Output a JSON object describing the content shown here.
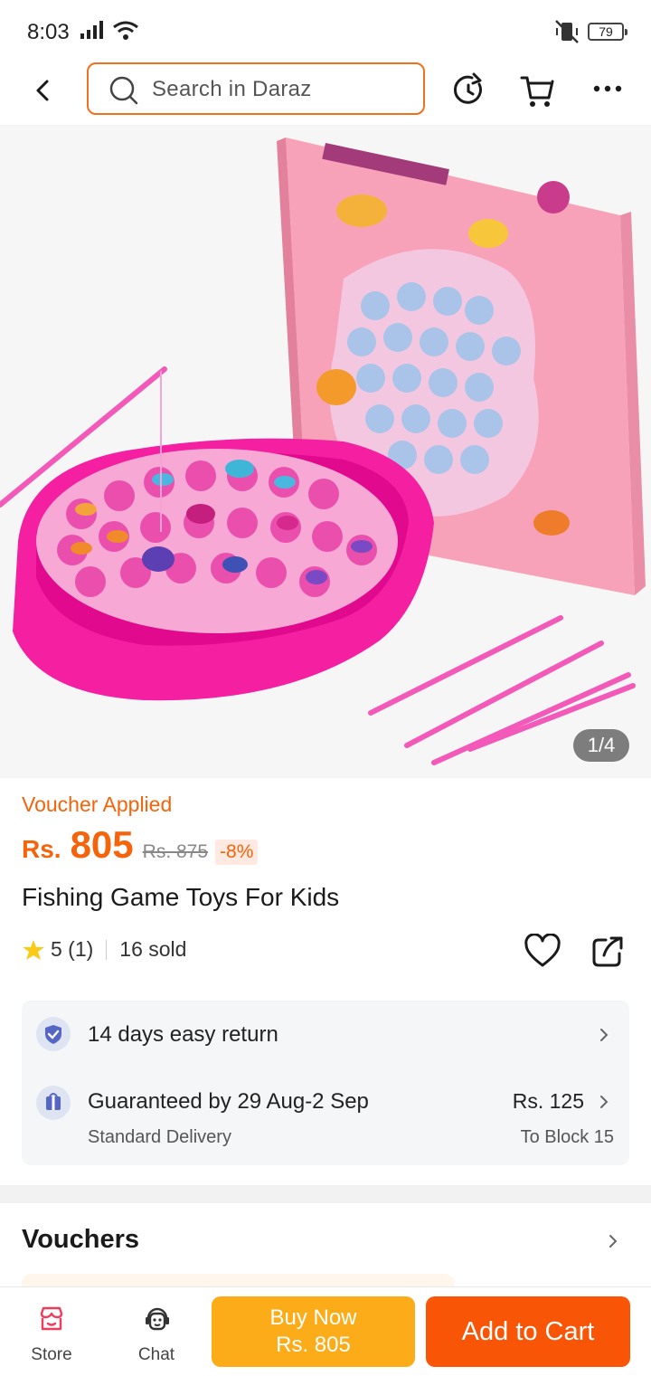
{
  "status_bar": {
    "time": "8:03",
    "battery": "79"
  },
  "search": {
    "placeholder": "Search in Daraz"
  },
  "gallery": {
    "counter": "1/4"
  },
  "product": {
    "voucher_label": "Voucher Applied",
    "currency": "Rs.",
    "price": "805",
    "old_price": "Rs. 875",
    "discount": "-8%",
    "title": "Fishing Game Toys For Kids",
    "rating": "5 (1)",
    "sold": "16 sold"
  },
  "services": {
    "return_text": "14 days easy return",
    "delivery_text": "Guaranteed by 29 Aug-2 Sep",
    "delivery_type": "Standard Delivery",
    "delivery_fee": "Rs. 125",
    "delivery_to": "To Block 15"
  },
  "vouchers": {
    "heading": "Vouchers"
  },
  "bottom_bar": {
    "store_label": "Store",
    "chat_label": "Chat",
    "buy_now_label": "Buy Now",
    "buy_now_price": "Rs. 805",
    "add_to_cart_label": "Add to Cart"
  },
  "colors": {
    "accent": "#f85606",
    "buy_now": "#fbac18",
    "price": "#f5630a",
    "toy_pink": "#f51fa2"
  }
}
